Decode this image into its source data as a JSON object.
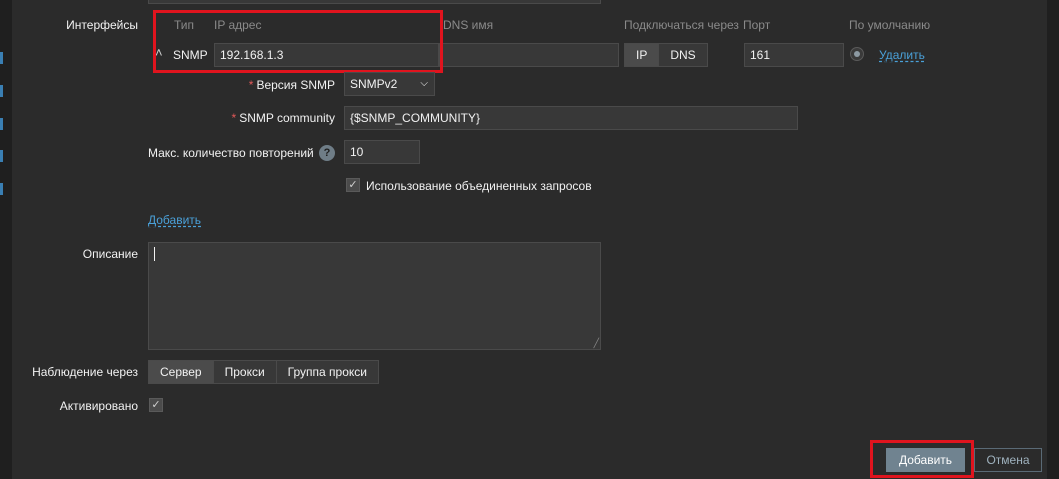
{
  "interfaces": {
    "label": "Интерфейсы",
    "headers": {
      "type": "Тип",
      "ip": "IP адрес",
      "dns": "DNS имя",
      "connect": "Подключаться через",
      "port": "Порт",
      "default": "По умолчанию"
    },
    "row": {
      "type": "SNMP",
      "ip": "192.168.1.3",
      "dns": "",
      "connect_options": [
        "IP",
        "DNS"
      ],
      "connect_selected": "IP",
      "port": "161",
      "remove_label": "Удалить"
    },
    "snmp_version": {
      "label": "Версия SNMP",
      "value": "SNMPv2"
    },
    "snmp_community": {
      "label": "SNMP community",
      "value": "{$SNMP_COMMUNITY}"
    },
    "max_repetitions": {
      "label": "Макс. количество повторений",
      "value": "10",
      "help": "?"
    },
    "bulk": {
      "label": "Использование объединенных запросов",
      "checked": true
    },
    "add_label": "Добавить"
  },
  "description": {
    "label": "Описание",
    "value": ""
  },
  "monitored_by": {
    "label": "Наблюдение через",
    "options": [
      "Сервер",
      "Прокси",
      "Группа прокси"
    ],
    "selected": "Сервер"
  },
  "enabled": {
    "label": "Активировано",
    "checked": true
  },
  "footer": {
    "add_button": "Добавить",
    "cancel_button": "Отмена"
  },
  "colors": {
    "accent_red": "#e0141e",
    "link": "#4aa0d8",
    "primary_button": "#708390"
  }
}
